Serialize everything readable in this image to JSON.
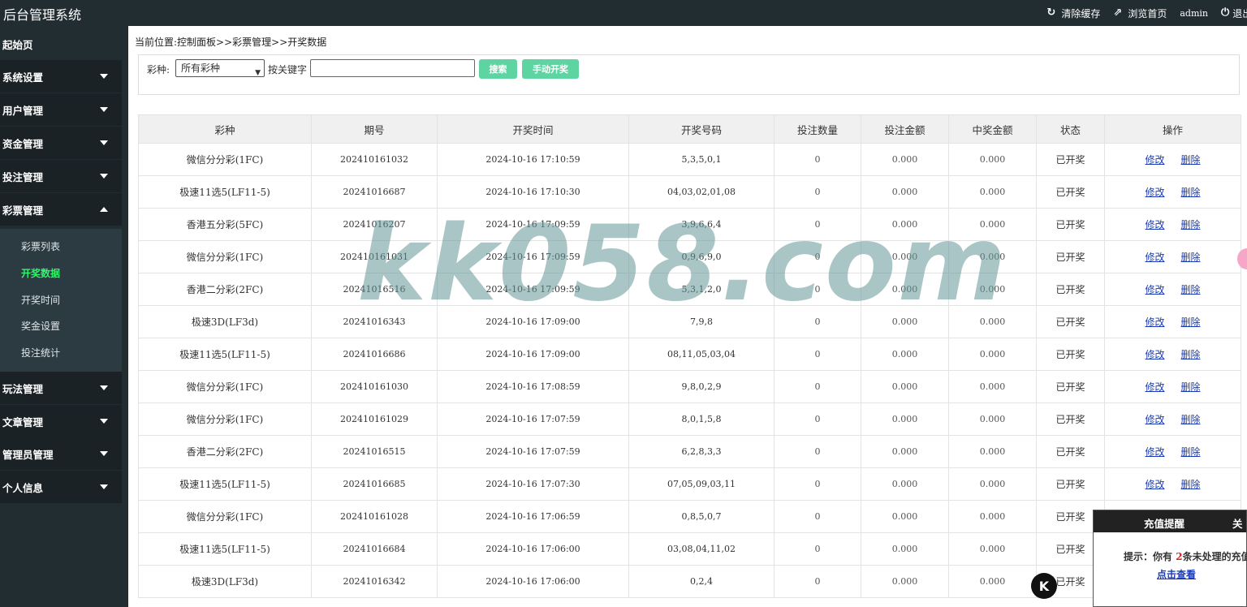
{
  "app": {
    "title": "后台管理系统"
  },
  "toolbar": {
    "clear_cache": "清除缓存",
    "browse_home": "浏览首页",
    "user": "admin",
    "logout": "退出"
  },
  "sidebar": {
    "items": [
      {
        "label": "起始页"
      },
      {
        "label": "系统设置"
      },
      {
        "label": "用户管理"
      },
      {
        "label": "资金管理"
      },
      {
        "label": "投注管理"
      },
      {
        "label": "彩票管理"
      },
      {
        "label": "玩法管理"
      },
      {
        "label": "文章管理"
      },
      {
        "label": "管理员管理"
      },
      {
        "label": "个人信息"
      }
    ],
    "sub_items": [
      {
        "label": "彩票列表"
      },
      {
        "label": "开奖数据"
      },
      {
        "label": "开奖时间"
      },
      {
        "label": "奖金设置"
      },
      {
        "label": "投注统计"
      }
    ]
  },
  "breadcrumb": "当前位置:控制面板>>彩票管理>>开奖数据",
  "search": {
    "lottery_label": "彩种:",
    "lottery_selected": "所有彩种",
    "keyword_label": "按关键字",
    "keyword_value": "",
    "search_button": "搜索",
    "manual_draw_button": "手动开奖"
  },
  "table": {
    "headers": [
      "彩种",
      "期号",
      "开奖时间",
      "开奖号码",
      "投注数量",
      "投注金额",
      "中奖金额",
      "状态",
      "操作"
    ],
    "edit_label": "修改",
    "delete_label": "删除",
    "rows": [
      [
        "微信分分彩(1FC)",
        "202410161032",
        "2024-10-16 17:10:59",
        "5,3,5,0,1",
        "0",
        "0.000",
        "0.000",
        "已开奖"
      ],
      [
        "极速11选5(LF11-5)",
        "20241016687",
        "2024-10-16 17:10:30",
        "04,03,02,01,08",
        "0",
        "0.000",
        "0.000",
        "已开奖"
      ],
      [
        "香港五分彩(5FC)",
        "20241016207",
        "2024-10-16 17:09:59",
        "3,9,6,6,4",
        "0",
        "0.000",
        "0.000",
        "已开奖"
      ],
      [
        "微信分分彩(1FC)",
        "202410161031",
        "2024-10-16 17:09:59",
        "0,9,6,9,0",
        "0",
        "0.000",
        "0.000",
        "已开奖"
      ],
      [
        "香港二分彩(2FC)",
        "20241016516",
        "2024-10-16 17:09:59",
        "5,3,1,2,0",
        "0",
        "0.000",
        "0.000",
        "已开奖"
      ],
      [
        "极速3D(LF3d)",
        "20241016343",
        "2024-10-16 17:09:00",
        "7,9,8",
        "0",
        "0.000",
        "0.000",
        "已开奖"
      ],
      [
        "极速11选5(LF11-5)",
        "20241016686",
        "2024-10-16 17:09:00",
        "08,11,05,03,04",
        "0",
        "0.000",
        "0.000",
        "已开奖"
      ],
      [
        "微信分分彩(1FC)",
        "202410161030",
        "2024-10-16 17:08:59",
        "9,8,0,2,9",
        "0",
        "0.000",
        "0.000",
        "已开奖"
      ],
      [
        "微信分分彩(1FC)",
        "202410161029",
        "2024-10-16 17:07:59",
        "8,0,1,5,8",
        "0",
        "0.000",
        "0.000",
        "已开奖"
      ],
      [
        "香港二分彩(2FC)",
        "20241016515",
        "2024-10-16 17:07:59",
        "6,2,8,3,3",
        "0",
        "0.000",
        "0.000",
        "已开奖"
      ],
      [
        "极速11选5(LF11-5)",
        "20241016685",
        "2024-10-16 17:07:30",
        "07,05,09,03,11",
        "0",
        "0.000",
        "0.000",
        "已开奖"
      ],
      [
        "微信分分彩(1FC)",
        "202410161028",
        "2024-10-16 17:06:59",
        "0,8,5,0,7",
        "0",
        "0.000",
        "0.000",
        "已开奖"
      ],
      [
        "极速11选5(LF11-5)",
        "20241016684",
        "2024-10-16 17:06:00",
        "03,08,04,11,02",
        "0",
        "0.000",
        "0.000",
        "已开奖"
      ],
      [
        "极速3D(LF3d)",
        "20241016342",
        "2024-10-16 17:06:00",
        "0,2,4",
        "0",
        "0.000",
        "0.000",
        "已开奖"
      ]
    ]
  },
  "watermark": "kk058.com",
  "popup": {
    "title": "充值提醒",
    "close": "关闭",
    "text_prefix": "提示：你有",
    "count": "2",
    "text_suffix": "条未处理的充值",
    "link": "点击查看"
  },
  "badge": "K"
}
